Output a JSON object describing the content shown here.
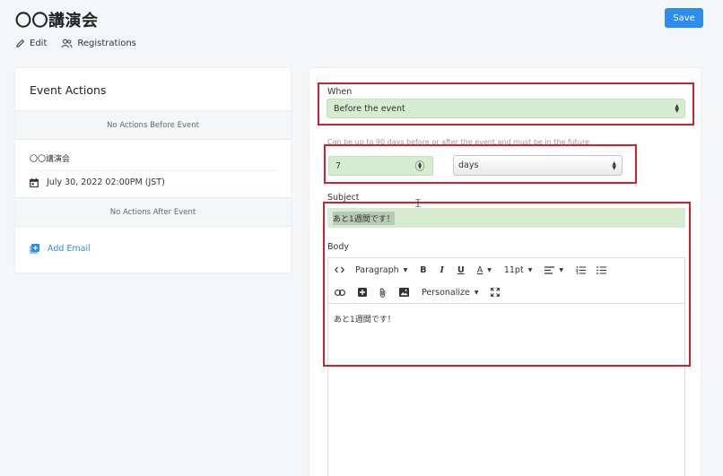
{
  "header": {
    "title": "〇〇講演会",
    "save_label": "Save"
  },
  "subnav": {
    "edit_label": "Edit",
    "registrations_label": "Registrations"
  },
  "event_actions": {
    "title": "Event Actions",
    "before_text": "No Actions Before Event",
    "event_name": "〇〇講演会",
    "event_date": "July 30, 2022 02:00PM (JST)",
    "after_text": "No Actions After Event",
    "add_email_label": "Add Email"
  },
  "form": {
    "when_label": "When",
    "when_value": "Before the event",
    "helper_text": "Can be up to 90 days before or after the event and must be in the future",
    "amount_value": "7",
    "unit_value": "days",
    "subject_label": "Subject",
    "subject_value": "あと1週間です！",
    "body_label": "Body",
    "body_text": "あと1週間です！"
  },
  "toolbar": {
    "paragraph_label": "Paragraph",
    "font_size_label": "11pt",
    "personalize_label": "Personalize"
  },
  "colors": {
    "accent": "#2d8cf0",
    "highlight_border": "#d3202a",
    "field_fill": "#d5ecd0"
  }
}
